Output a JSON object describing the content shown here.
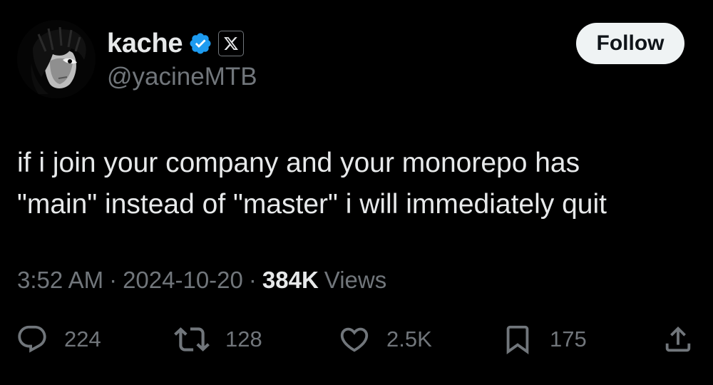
{
  "author": {
    "display_name": "kache",
    "handle": "@yacineMTB",
    "verified": true,
    "accent_color": "#1d9bf0"
  },
  "follow_button": {
    "label": "Follow"
  },
  "tweet": {
    "text": "if i join your company and your monorepo has\n\"main\" instead of \"master\" i will immediately quit"
  },
  "meta": {
    "time": "3:52 AM",
    "separator": "·",
    "date": "2024-10-20",
    "views_count": "384K",
    "views_label": "Views"
  },
  "actions": {
    "reply": {
      "icon": "reply-icon",
      "count": "224"
    },
    "retweet": {
      "icon": "retweet-icon",
      "count": "128"
    },
    "like": {
      "icon": "heart-icon",
      "count": "2.5K"
    },
    "bookmark": {
      "icon": "bookmark-icon",
      "count": "175"
    },
    "share": {
      "icon": "share-icon"
    }
  }
}
